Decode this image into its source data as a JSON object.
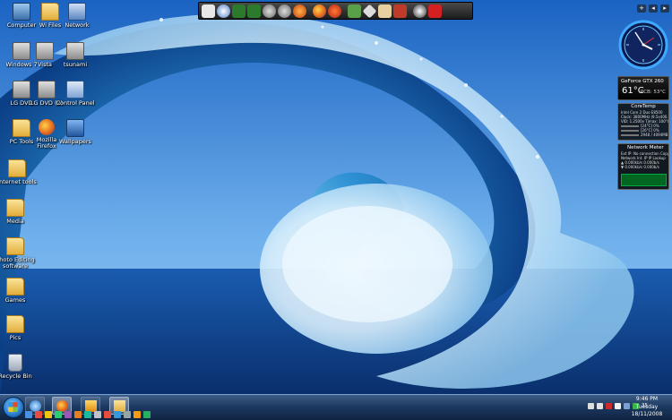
{
  "desktop": {
    "icons": [
      {
        "label": "Computer"
      },
      {
        "label": "Wi Files"
      },
      {
        "label": "Network"
      },
      {
        "label": "Windows 7"
      },
      {
        "label": "Vista"
      },
      {
        "label": "tsunami"
      },
      {
        "label": "LG DVD"
      },
      {
        "label": "LG DVD (2)"
      },
      {
        "label": "Control Panel"
      },
      {
        "label": "PC Tools"
      },
      {
        "label": "Mozilla Firefox"
      },
      {
        "label": "Wallpapers"
      },
      {
        "label": "Internet tools"
      },
      {
        "label": "Media"
      },
      {
        "label": "Photo Editing software"
      },
      {
        "label": "Games"
      },
      {
        "label": "Pics"
      },
      {
        "label": "Recycle Bin"
      }
    ]
  },
  "dock": {
    "icons": [
      "zorro-icon",
      "messenger-icon",
      "graph-icon",
      "graph-icon-2",
      "people-icon",
      "people-icon-2",
      "gimp-icon",
      "firefox-icon",
      "ccleaner-icon",
      "photo-icon",
      "folder-icon",
      "pdf-icon",
      "network-icon",
      "media-icon",
      "power-icon"
    ]
  },
  "sidebar": {
    "controls": [
      "+",
      "◂",
      "▸"
    ],
    "gpu": {
      "name": "GeForce GTX 260",
      "temp": "61°C",
      "pcb": "PCB: 53°C"
    },
    "coretemp": {
      "title": "CoreTemp",
      "rows": [
        "Intel Core 2 Duo E8500",
        "Clock: 3800MHz (9.5x400.0)",
        "VID: 1.2500v   Tjmax: 100°C",
        "[24°C]   0%",
        "[26°C]   0%",
        "2948 / 4094MB"
      ]
    },
    "netmeter": {
      "title": "Network Meter",
      "rows": [
        "Ext IP: No connection  Copy",
        "Network Int. IP      IP Lookup",
        "▲ 0.000kb/s    0.000b/s",
        "▼ 0.000kb/s    0.000b/s"
      ]
    }
  },
  "taskbar": {
    "clock_time": "9:46 PM",
    "clock_day": "Tuesday",
    "clock_date": "18/11/2008",
    "tray_number": "35"
  },
  "colors": {
    "taskbar_top": "#3d5d86",
    "taskbar_bottom": "#0f2340",
    "sky": "#3f8be0",
    "wave_dark": "#0b3f86",
    "foam": "#eaf6ff"
  }
}
